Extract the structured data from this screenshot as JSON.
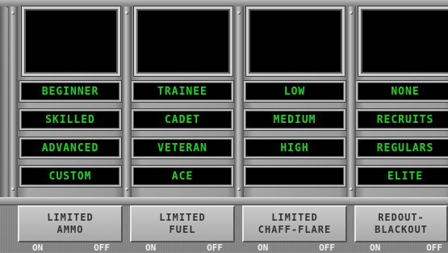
{
  "columns": [
    {
      "options": [
        "BEGINNER",
        "SKILLED",
        "ADVANCED",
        "CUSTOM"
      ],
      "button": {
        "line1": "LIMITED",
        "line2": "AMMO"
      },
      "toggle": {
        "on": "ON",
        "off": "OFF"
      }
    },
    {
      "options": [
        "TRAINEE",
        "CADET",
        "VETERAN",
        "ACE"
      ],
      "button": {
        "line1": "LIMITED",
        "line2": "FUEL"
      },
      "toggle": {
        "on": "ON",
        "off": "OFF"
      }
    },
    {
      "options": [
        "LOW",
        "MEDIUM",
        "HIGH",
        ""
      ],
      "button": {
        "line1": "LIMITED",
        "line2": "CHAFF-FLARE"
      },
      "toggle": {
        "on": "ON",
        "off": "OFF"
      }
    },
    {
      "options": [
        "NONE",
        "RECRUITS",
        "REGULARS",
        "ELITE"
      ],
      "button": {
        "line1": "REDOUT-",
        "line2": "BLACKOUT"
      },
      "toggle": {
        "on": "ON",
        "off": "OFF"
      }
    }
  ],
  "colors": {
    "option_text": "#29c529",
    "panel": "#8c8c8c"
  }
}
